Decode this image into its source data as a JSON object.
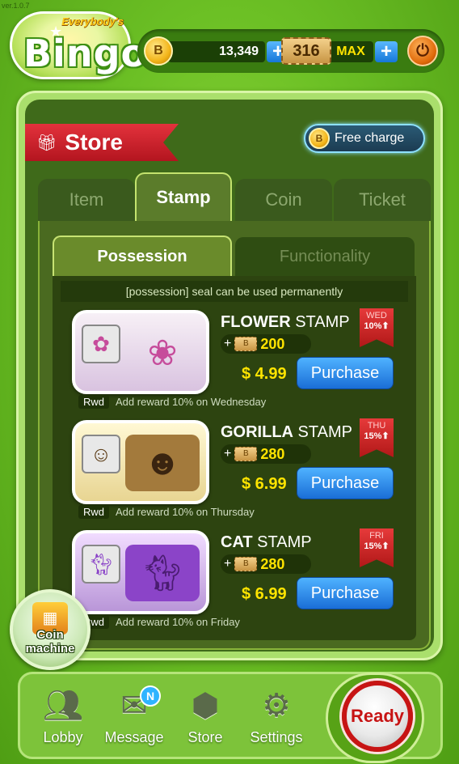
{
  "app": {
    "version": "ver.1.0.7",
    "logo_sub": "Everybody's",
    "logo_main": "Bingo"
  },
  "hud": {
    "coins": "13,349",
    "tickets": "316",
    "ticket_status": "MAX",
    "plus_label": "+",
    "coin_symbol": "B",
    "power_symbol": "⏻"
  },
  "store": {
    "title": "Store",
    "free_charge_label": "Free charge",
    "tabs": [
      {
        "label": "Item",
        "active": false
      },
      {
        "label": "Stamp",
        "active": true
      },
      {
        "label": "Coin",
        "active": false
      },
      {
        "label": "Ticket",
        "active": false
      }
    ],
    "subtabs": [
      {
        "label": "Possession",
        "active": true
      },
      {
        "label": "Functionality",
        "active": false
      }
    ],
    "notice": "[possession] seal can be used permanently",
    "items": [
      {
        "name_bold": "FLOWER",
        "name_rest": " STAMP",
        "bonus_plus": "+",
        "bonus": "200",
        "price": "$ 4.99",
        "purchase_label": "Purchase",
        "day": "WED",
        "day_pct": "10%⬆",
        "rwd_tag": "Rwd",
        "rwd_text": "Add reward 10% on Wednesday",
        "art_icon": "flower-icon"
      },
      {
        "name_bold": "GORILLA",
        "name_rest": " STAMP",
        "bonus_plus": "+",
        "bonus": "280",
        "price": "$ 6.99",
        "purchase_label": "Purchase",
        "day": "THU",
        "day_pct": "15%⬆",
        "rwd_tag": "Rwd",
        "rwd_text": "Add reward 10% on Thursday",
        "art_icon": "gorilla-icon"
      },
      {
        "name_bold": "CAT",
        "name_rest": " STAMP",
        "bonus_plus": "+",
        "bonus": "280",
        "price": "$ 6.99",
        "purchase_label": "Purchase",
        "day": "FRI",
        "day_pct": "15%⬆",
        "rwd_tag": "Rwd",
        "rwd_text": "Add reward 10% on Friday",
        "art_icon": "cat-icon"
      }
    ]
  },
  "coin_machine": {
    "label_line1": "Coin",
    "label_line2": "machine"
  },
  "nav": {
    "items": [
      {
        "label": "Lobby",
        "icon": "people-icon"
      },
      {
        "label": "Message",
        "icon": "envelope-icon",
        "badge": "N"
      },
      {
        "label": "Store",
        "icon": "box-icon"
      },
      {
        "label": "Settings",
        "icon": "gear-icon"
      }
    ],
    "ready_label": "Ready"
  },
  "colors": {
    "accent_blue": "#1a6ed6",
    "price_yellow": "#ffe400",
    "ribbon_red": "#c71414",
    "panel_green": "#3f6a1a"
  }
}
